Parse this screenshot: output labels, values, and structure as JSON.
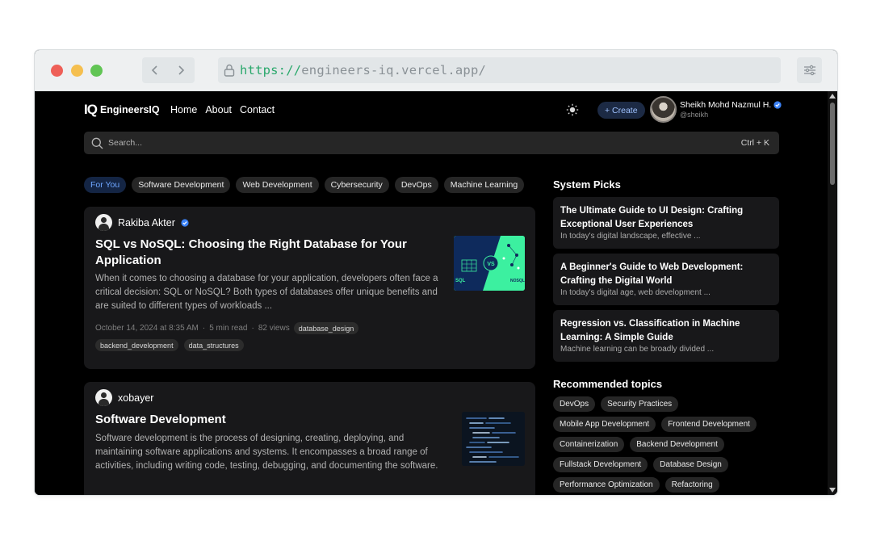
{
  "browser": {
    "url_scheme": "https://",
    "url_host": "engineers-iq.vercel.app/"
  },
  "site": {
    "logo_mark": "IQ",
    "logo_text": "EngineersIQ",
    "nav": [
      "Home",
      "About",
      "Contact"
    ],
    "create_label": "+ Create",
    "user": {
      "name": "Sheikh Mohd Nazmul H.",
      "handle": "@sheikh"
    }
  },
  "search": {
    "placeholder": "Search...",
    "shortcut": "Ctrl + K"
  },
  "feed_tabs": [
    {
      "label": "For You",
      "active": true
    },
    {
      "label": "Software Development",
      "active": false
    },
    {
      "label": "Web Development",
      "active": false
    },
    {
      "label": "Cybersecurity",
      "active": false
    },
    {
      "label": "DevOps",
      "active": false
    },
    {
      "label": "Machine Learning",
      "active": false
    }
  ],
  "posts": [
    {
      "author": "Rakiba Akter",
      "verified": true,
      "title": "SQL vs NoSQL: Choosing the Right Database for Your Application",
      "excerpt": "When it comes to choosing a database for your application, developers often face a critical decision: SQL or NoSQL? Both types of databases offer unique benefits and are suited to different types of workloads ...",
      "date": "October 14, 2024 at 8:35 AM",
      "read_time": "5 min read",
      "views": "82 views",
      "tags": [
        "database_design",
        "backend_development",
        "data_structures"
      ],
      "thumb_labels": {
        "left": "SQL",
        "middle": "VS",
        "right": "NOSQL"
      }
    },
    {
      "author": "xobayer",
      "verified": false,
      "title": "Software Development",
      "excerpt": "Software development is the process of designing, creating, deploying, and maintaining software applications and systems. It encompasses a broad range of activities, including writing code, testing, debugging, and documenting the software."
    }
  ],
  "system_picks": {
    "heading": "System Picks",
    "items": [
      {
        "title": "The Ultimate Guide to UI Design: Crafting Exceptional User Experiences",
        "excerpt": "In today's digital landscape, effective ..."
      },
      {
        "title": "A Beginner's Guide to Web Development: Crafting the Digital World",
        "excerpt": "In today's digital age, web development ..."
      },
      {
        "title": "Regression vs. Classification in Machine Learning: A Simple Guide",
        "excerpt": "Machine learning can be broadly divided ..."
      }
    ]
  },
  "recommended": {
    "heading": "Recommended topics",
    "topics": [
      "DevOps",
      "Security Practices",
      "Mobile App Development",
      "Frontend Development",
      "Containerization",
      "Backend Development",
      "Fullstack Development",
      "Database Design",
      "Performance Optimization",
      "Refactoring"
    ]
  },
  "colors": {
    "accent": "#6ea6ff",
    "verified": "#3b82f6",
    "background": "#000000",
    "card": "#18181a"
  }
}
